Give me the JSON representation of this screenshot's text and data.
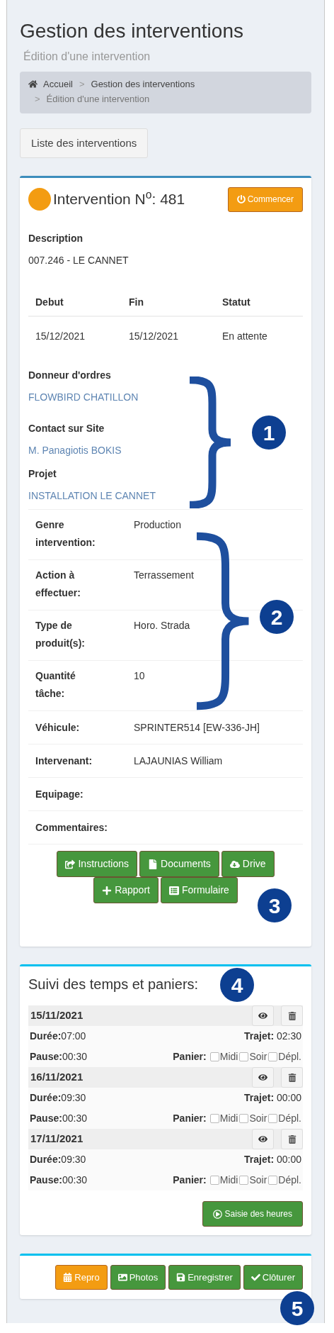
{
  "header": {
    "title": "Gestion des interventions",
    "subtitle": "Édition d'une intervention"
  },
  "breadcrumb": [
    {
      "label": "Accueil",
      "active": false
    },
    {
      "separator": ">",
      "label": "Gestion des interventions",
      "active": false
    },
    {
      "separator": ">",
      "label": "Édition d'une intervention",
      "active": true
    }
  ],
  "list_button": "Liste des interventions",
  "intervention": {
    "title": "Intervention N$^{o}$: 481",
    "start_button": {
      "label": "Commencer"
    },
    "description": {
      "label": "Description",
      "value": "007.246 - LE CANNET"
    },
    "dates_table": {
      "columns": [
        "Debut",
        "Fin",
        "Statut"
      ],
      "rows": [
        [
          "15/12/2021",
          "15/12/2021",
          "En attente"
        ]
      ]
    },
    "contacts": [
      {
        "label": "Donneur d'ordres",
        "value": "FLOWBIRD CHATILLON"
      },
      {
        "label": "Contact sur Site",
        "value": "M. Panagiotis BOKIS"
      },
      {
        "label": "Projet",
        "value": "INSTALLATION LE CANNET"
      }
    ],
    "details": [
      {
        "label": "Genre intervention:",
        "value": "Production"
      },
      {
        "label": "Action à effectuer:",
        "value": "Terrassement"
      },
      {
        "label": "Type de produit(s):",
        "value": "Horo. Strada"
      },
      {
        "label": "Quantité tâche:",
        "value": "10"
      },
      {
        "label": "Véhicule:",
        "value": "SPRINTER514 [EW-336-JH]"
      },
      {
        "label": "Intervenant:",
        "value": "LAJAUNIAS William"
      },
      {
        "label": "Equipage:"
      },
      {
        "label": "Commentaires:"
      }
    ],
    "actions": [
      {
        "label": "Instructions"
      },
      {
        "label": "Documents"
      },
      {
        "label": "Drive"
      },
      {
        "label": "Rapport"
      },
      {
        "label": "Formulaire"
      }
    ]
  },
  "time_tracking": {
    "title": "Suivi des temps et paniers:",
    "entries": [
      {
        "date": "15/11/2021",
        "duree_label": "Durée:",
        "duree": "07:00",
        "trajet_label": "Trajet:",
        "trajet": "02:30",
        "pause_label": "Pause:",
        "pause": "00:30",
        "panier_label": "Panier:",
        "options": [
          {
            "label": "Midi",
            "checked": false
          },
          {
            "label": "Soir",
            "checked": false
          },
          {
            "label": "Dépl.",
            "checked": false
          }
        ]
      },
      {
        "date": "16/11/2021",
        "duree_label": "Durée:",
        "duree": "09:30",
        "trajet_label": "Trajet:",
        "trajet": "00:00",
        "pause_label": "Pause:",
        "pause": "00:30",
        "panier_label": "Panier:",
        "options": [
          {
            "label": "Midi",
            "checked": false
          },
          {
            "label": "Soir",
            "checked": false
          },
          {
            "label": "Dépl.",
            "checked": false
          }
        ]
      },
      {
        "date": "17/11/2021",
        "duree_label": "Durée:",
        "duree": "09:30",
        "trajet_label": "Trajet:",
        "trajet": "00:00",
        "pause_label": "Pause:",
        "pause": "00:30",
        "panier_label": "Panier:",
        "options": [
          {
            "label": "Midi",
            "checked": false
          },
          {
            "label": "Soir",
            "checked": false
          },
          {
            "label": "Dépl.",
            "checked": false
          }
        ]
      }
    ],
    "submit_button": {
      "label": "Saisie des heures"
    }
  },
  "footer_buttons": [
    {
      "label": "Repro",
      "kind": "warning"
    },
    {
      "label": "Photos",
      "kind": "success"
    },
    {
      "label": "Enregistrer",
      "kind": "success"
    },
    {
      "label": "Clôturer",
      "kind": "success"
    }
  ],
  "annotations": [
    {
      "number": "1"
    },
    {
      "number": "2"
    },
    {
      "number": "3"
    },
    {
      "number": "4"
    },
    {
      "number": "5"
    }
  ]
}
